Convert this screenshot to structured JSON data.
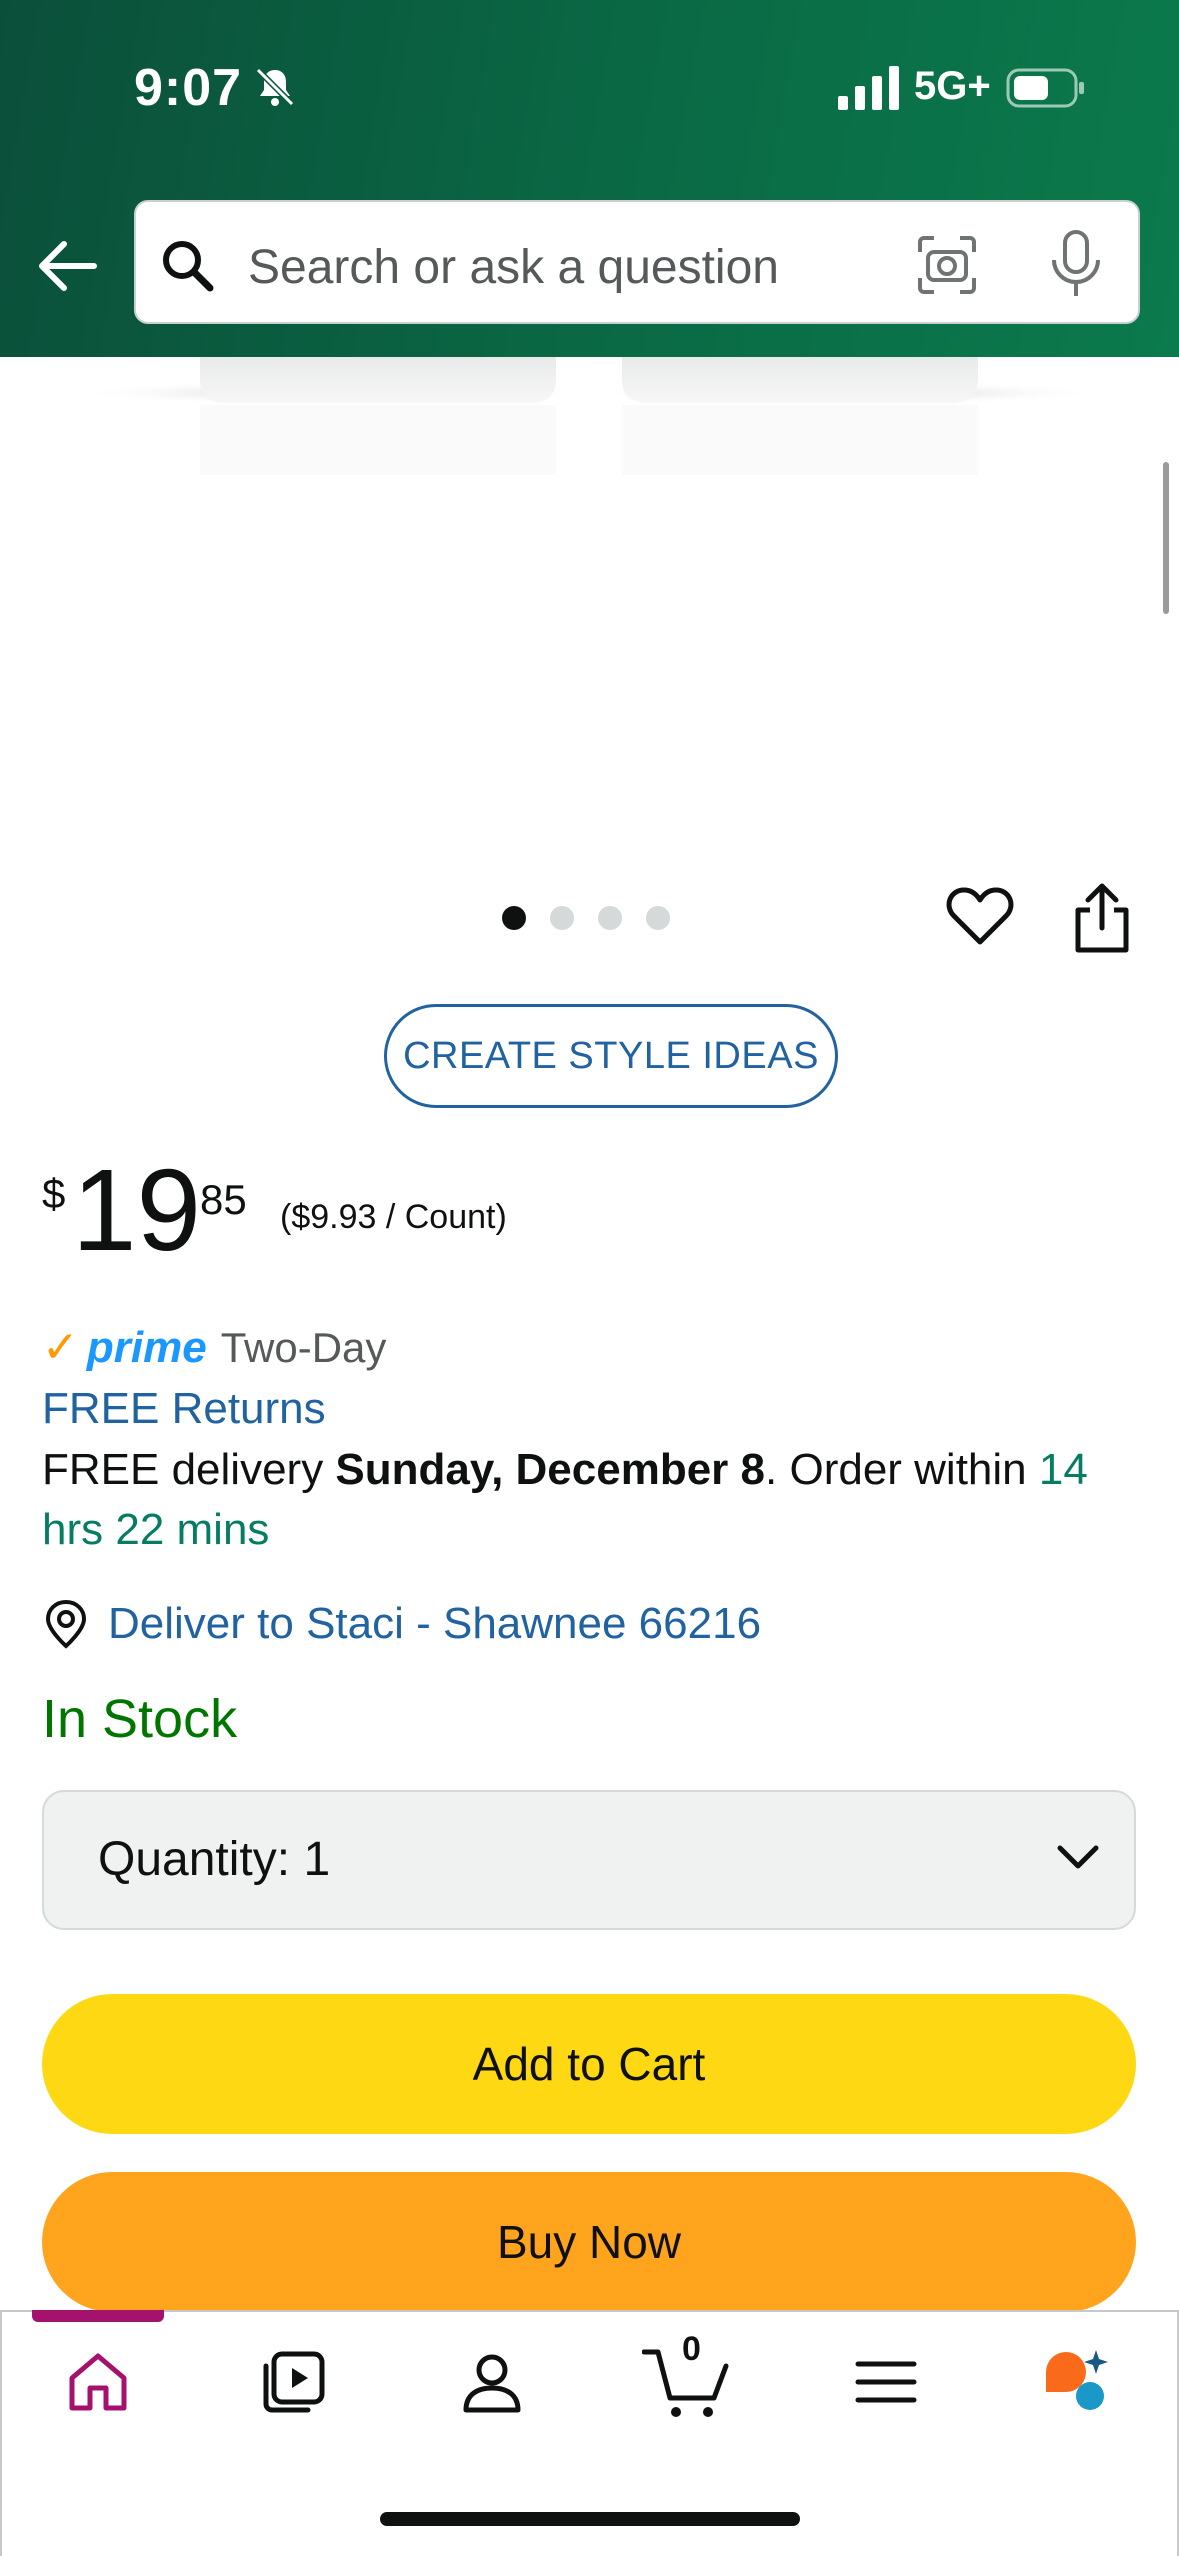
{
  "status_bar": {
    "time": "9:07",
    "network": "5G+"
  },
  "search": {
    "placeholder": "Search or ask a question"
  },
  "product": {
    "image_count": 4,
    "active_image": 1,
    "style_button": "CREATE STYLE IDEAS",
    "price": {
      "symbol": "$",
      "whole": "19",
      "fraction": "85",
      "unit_price": "($9.93 / Count)"
    },
    "prime": {
      "logo": "prime",
      "label": "Two-Day"
    },
    "free_returns": "FREE Returns",
    "delivery": {
      "prefix": "FREE delivery ",
      "date": "Sunday, December 8",
      "middle": ". Order within ",
      "countdown": "14 hrs 22 mins"
    },
    "deliver_to": "Deliver to Staci - Shawnee 66216",
    "stock": "In Stock",
    "quantity_label": "Quantity:",
    "quantity_value": "1",
    "add_to_cart": "Add to Cart",
    "buy_now": "Buy Now"
  },
  "bottom_nav": {
    "items": [
      "home-icon",
      "video-icon",
      "account-icon",
      "cart-icon",
      "menu-icon",
      "rufus-icon"
    ],
    "active": "home",
    "cart_count": "0"
  },
  "colors": {
    "header_green": "#0a6a45",
    "link_blue": "#2162a1",
    "stock_green": "#007600",
    "add_to_cart": "#ffd814",
    "buy_now": "#ffa41c",
    "nav_active": "#a5126e"
  }
}
